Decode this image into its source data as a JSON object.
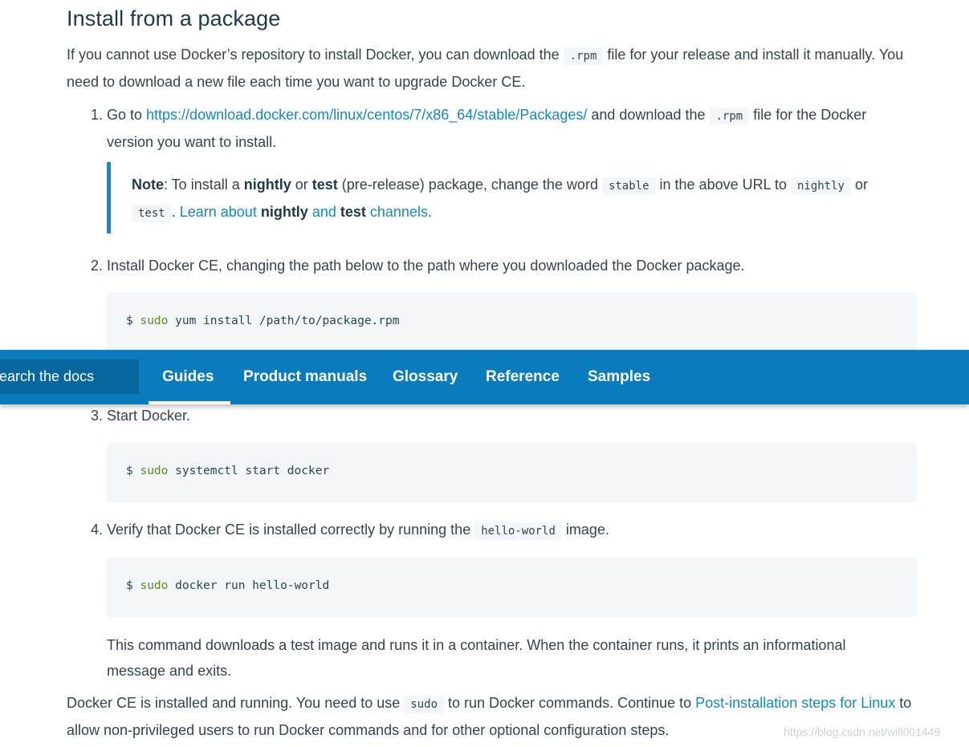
{
  "heading": "Install from a package",
  "intro": {
    "t1": "If you cannot use Docker’s repository to install Docker, you can download the ",
    "code": ".rpm",
    "t2": " file for your release and install it manually. You need to download a new file each time you want to upgrade Docker CE."
  },
  "step1": {
    "number": "1.",
    "t1": "Go to ",
    "link": "https://download.docker.com/linux/centos/7/x86_64/stable/Packages/",
    "t2": " and download the ",
    "code": ".rpm",
    "t3": " file for the Docker version you want to install."
  },
  "note": {
    "label": "Note",
    "t1": ": To install a ",
    "b1": "nightly",
    "t2": " or ",
    "b2": "test",
    "t3": " (pre-release) package, change the word ",
    "code1": "stable",
    "t4": " in the above URL to ",
    "code2": "nightly",
    "t5": " or ",
    "code3": "test",
    "t6": ". ",
    "link1": "Learn about ",
    "link_b1": "nightly",
    "link2": " and ",
    "link_b2": "test",
    "link3": " channels",
    "t7": "."
  },
  "step2": {
    "number": "2.",
    "text": "Install Docker CE, changing the path below to the path where you downloaded the Docker package.",
    "prompt": "$ ",
    "kw": "sudo",
    "cmd": " yum install /path/to/package.rpm"
  },
  "step3": {
    "number": "3.",
    "text": "Start Docker.",
    "prompt": "$ ",
    "kw": "sudo",
    "cmd": " systemctl start docker"
  },
  "step4": {
    "number": "4.",
    "t1": "Verify that Docker CE is installed correctly by running the ",
    "code": "hello-world",
    "t2": " image.",
    "prompt": "$ ",
    "kw": "sudo",
    "cmd": " docker run hello-world",
    "after": "This command downloads a test image and runs it in a container. When the container runs, it prints an informational message and exits."
  },
  "final": {
    "t1": "Docker CE is installed and running. You need to use ",
    "code": "sudo",
    "t2": " to run Docker commands. Continue to ",
    "link": "Post-installation steps for Linux",
    "t3": " to allow non-privileged users to run Docker commands and for other optional configuration steps."
  },
  "navbar": {
    "search_text": "Search the docs",
    "tabs": [
      "Guides",
      "Product manuals",
      "Glossary",
      "Reference",
      "Samples"
    ],
    "active_tab": "Guides"
  },
  "watermark": "https://blog.csdn.net/will001449",
  "colors": {
    "nav_bg": "#0a7cbd",
    "link": "#1488c6",
    "code_bg": "#f3f6f9",
    "note_border": "#1488c6"
  }
}
